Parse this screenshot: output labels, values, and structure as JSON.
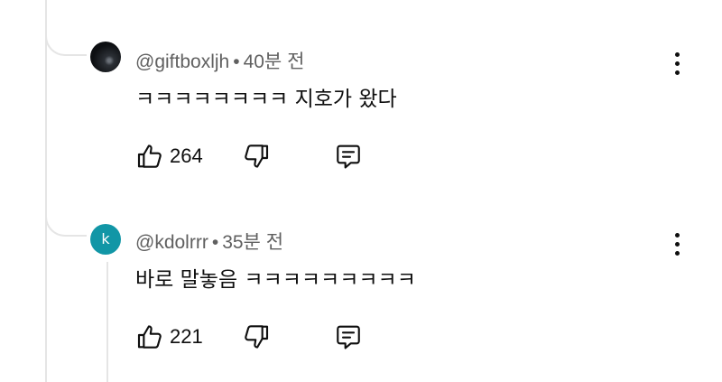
{
  "replies": [
    {
      "handle": "@giftboxljh",
      "separator": "•",
      "time": "40분 전",
      "text": "ㅋㅋㅋㅋㅋㅋㅋㅋ 지호가 왔다",
      "like_count": "264",
      "avatar_letter": ""
    },
    {
      "handle": "@kdolrrr",
      "separator": "•",
      "time": "35분 전",
      "text": "바로 말놓음 ㅋㅋㅋㅋㅋㅋㅋㅋㅋ",
      "like_count": "221",
      "avatar_letter": "k"
    }
  ],
  "icons": {
    "like": "thumb-up-icon",
    "dislike": "thumb-down-icon",
    "reply": "reply-comment-icon",
    "more": "more-vertical-icon"
  },
  "colors": {
    "text": "#0f0f0f",
    "meta": "#606060",
    "avatar_k_bg": "#1196a6",
    "thread_line": "#e5e5e5"
  }
}
